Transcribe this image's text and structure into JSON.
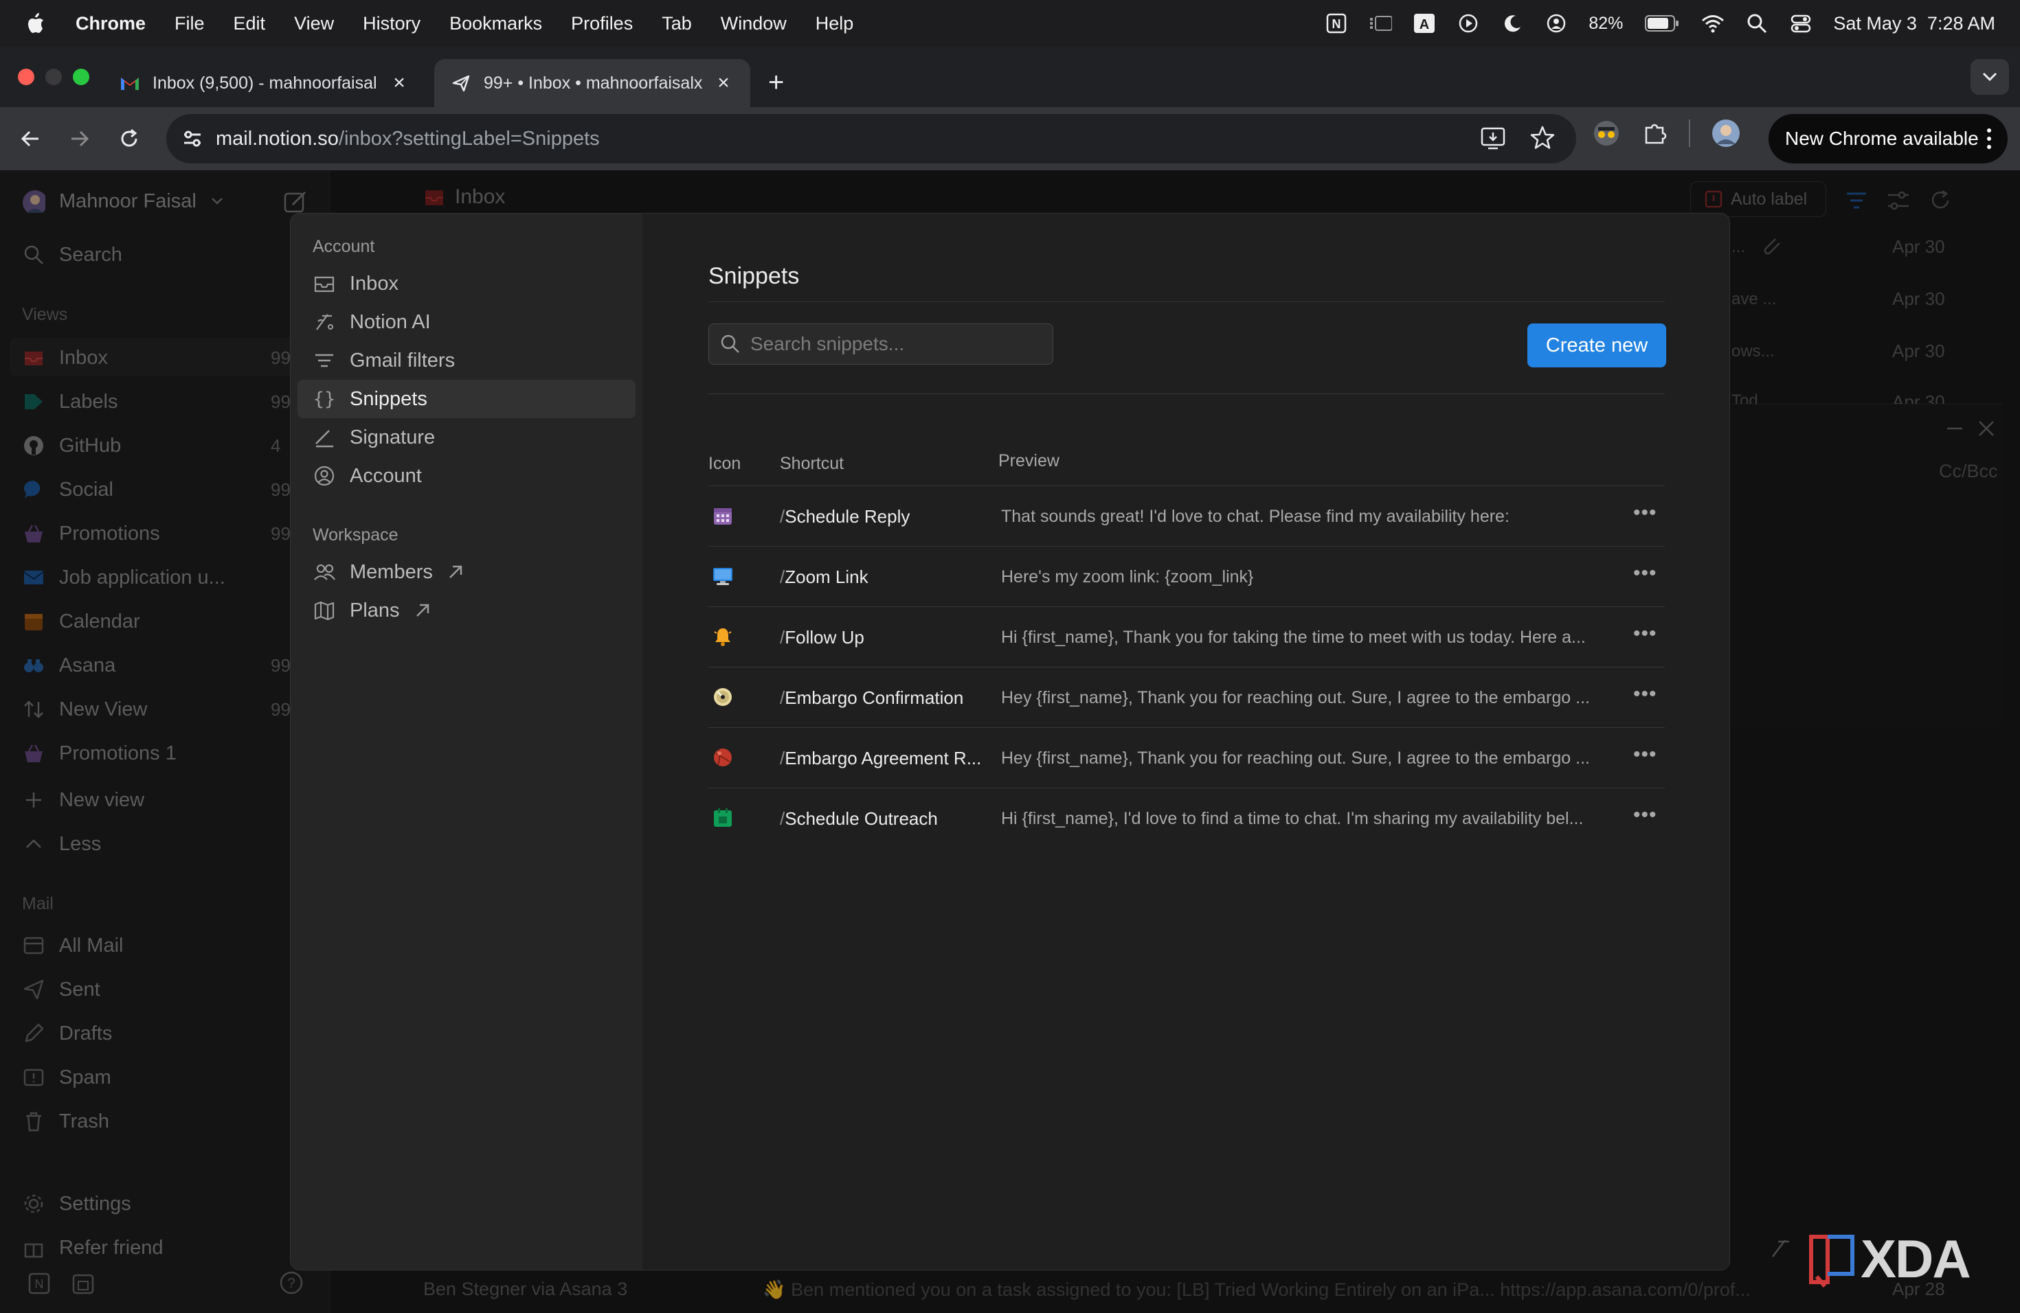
{
  "menubar": {
    "app": "Chrome",
    "items": [
      "File",
      "Edit",
      "View",
      "History",
      "Bookmarks",
      "Profiles",
      "Tab",
      "Window",
      "Help"
    ],
    "battery": "82%",
    "datetime": "Sat May 3  7:28 AM"
  },
  "tabs": [
    {
      "title": "Inbox (9,500) - mahnoorfaisal",
      "icon": "gmail-icon"
    },
    {
      "title": "99+ • Inbox • mahnoorfaisalx",
      "icon": "notion-mail-icon"
    }
  ],
  "address": {
    "host": "mail.notion.so",
    "path": "/inbox?settingLabel=Snippets"
  },
  "chrome_notice": "New Chrome available",
  "sidebar": {
    "user": "Mahnoor Faisal",
    "search": "Search",
    "views_heading": "Views",
    "views": [
      {
        "label": "Inbox",
        "count": "99",
        "color": "#e03e3e"
      },
      {
        "label": "Labels",
        "count": "99",
        "color": "#0f7b6c"
      },
      {
        "label": "GitHub",
        "count": "4",
        "color": "#9b9b9b"
      },
      {
        "label": "Social",
        "count": "99",
        "color": "#2383e2"
      },
      {
        "label": "Promotions",
        "count": "99",
        "color": "#9065b0"
      },
      {
        "label": "Job application u...",
        "count": "",
        "color": "#2383e2"
      },
      {
        "label": "Calendar",
        "count": "",
        "color": "#d9730d"
      },
      {
        "label": "Asana",
        "count": "99",
        "color": "#2383e2"
      },
      {
        "label": "New View",
        "count": "99",
        "color": "#9b9b9b"
      },
      {
        "label": "Promotions 1",
        "count": "",
        "color": "#9065b0"
      }
    ],
    "new_view": "New view",
    "less": "Less",
    "mail_heading": "Mail",
    "mail": [
      "All Mail",
      "Sent",
      "Drafts",
      "Spam",
      "Trash"
    ],
    "settings": "Settings",
    "refer": "Refer friend"
  },
  "mail": {
    "header": "Inbox",
    "auto_label": "Auto label",
    "dates": [
      "Apr 30",
      "Apr 30",
      "Apr 30",
      "Apr 30"
    ],
    "fragments": [
      "...",
      "ave ...",
      "ows...",
      "Tod..."
    ],
    "cc": "Cc/Bcc",
    "bottom_sender": "Ben Stegner via Asana  3",
    "bottom_subject": "👋 Ben mentioned you on a task assigned to you: [LB] Tried Working Entirely on an iPa...  https://app.asana.com/0/prof...",
    "bottom_date": "Apr 28"
  },
  "settings_nav": {
    "account_heading": "Account",
    "account_items": [
      {
        "label": "Inbox",
        "icon": "inbox-icon"
      },
      {
        "label": "Notion AI",
        "icon": "notion-ai-icon"
      },
      {
        "label": "Gmail filters",
        "icon": "filter-icon"
      },
      {
        "label": "Snippets",
        "icon": "braces-icon",
        "active": true
      },
      {
        "label": "Signature",
        "icon": "signature-icon"
      },
      {
        "label": "Account",
        "icon": "account-icon"
      }
    ],
    "workspace_heading": "Workspace",
    "workspace_items": [
      {
        "label": "Members",
        "icon": "members-icon"
      },
      {
        "label": "Plans",
        "icon": "map-icon"
      }
    ]
  },
  "snippets": {
    "title": "Snippets",
    "search_placeholder": "Search snippets...",
    "create_label": "Create new",
    "columns": {
      "icon": "Icon",
      "shortcut": "Shortcut",
      "preview": "Preview"
    },
    "rows": [
      {
        "icon": "calendar-icon",
        "color": "#9065b0",
        "shortcut": "Schedule Reply",
        "preview": "That sounds great! I'd love to chat. Please find my availability here:"
      },
      {
        "icon": "computer-icon",
        "color": "#2383e2",
        "shortcut": "Zoom Link",
        "preview": "Here's my zoom link: {zoom_link}"
      },
      {
        "icon": "bell-icon",
        "color": "#f5a623",
        "shortcut": "Follow Up",
        "preview": "Hi {first_name}, Thank you for taking the time to meet with us today. Here a..."
      },
      {
        "icon": "disc-icon",
        "color": "#e8d9a0",
        "shortcut": "Embargo Confirmation",
        "preview": "Hey {first_name}, Thank you for reaching out. Sure, I agree to the embargo ..."
      },
      {
        "icon": "ball-icon",
        "color": "#c0392b",
        "shortcut": "Embargo Agreement R...",
        "preview": "Hey {first_name}, Thank you for reaching out. Sure, I agree to the embargo ..."
      },
      {
        "icon": "calendar-green-icon",
        "color": "#0f9d58",
        "shortcut": "Schedule Outreach",
        "preview": "Hi {first_name}, I'd love to find a time to chat. I'm sharing my availability bel..."
      }
    ]
  },
  "watermark": "XDA"
}
